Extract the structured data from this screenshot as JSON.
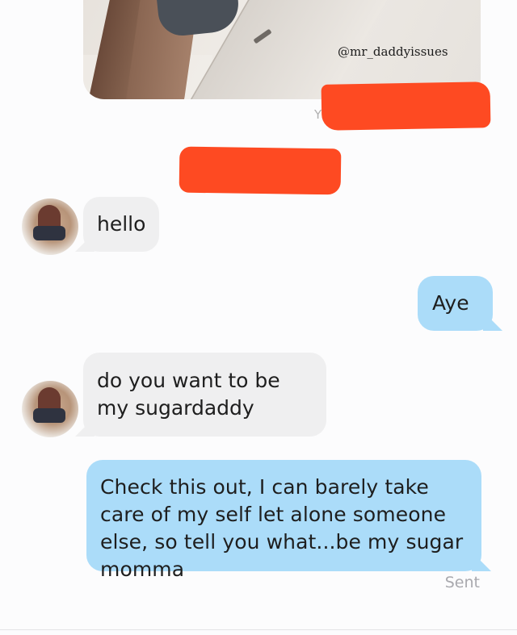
{
  "image": {
    "watermark": "@mr_daddyissues"
  },
  "chat": {
    "messages": [
      {
        "direction": "incoming",
        "text": "hello"
      },
      {
        "direction": "outgoing",
        "text": "Aye"
      },
      {
        "direction": "incoming",
        "text": "do you want to be my sugardaddy"
      },
      {
        "direction": "outgoing",
        "text": "Check this out, I can barely take care of my self let alone someone else, so tell you what...be my sugar momma"
      }
    ],
    "status": "Sent"
  },
  "colors": {
    "incoming_bubble": "#efeff0",
    "outgoing_bubble": "#abdcf9",
    "redaction": "#fe4a22"
  }
}
